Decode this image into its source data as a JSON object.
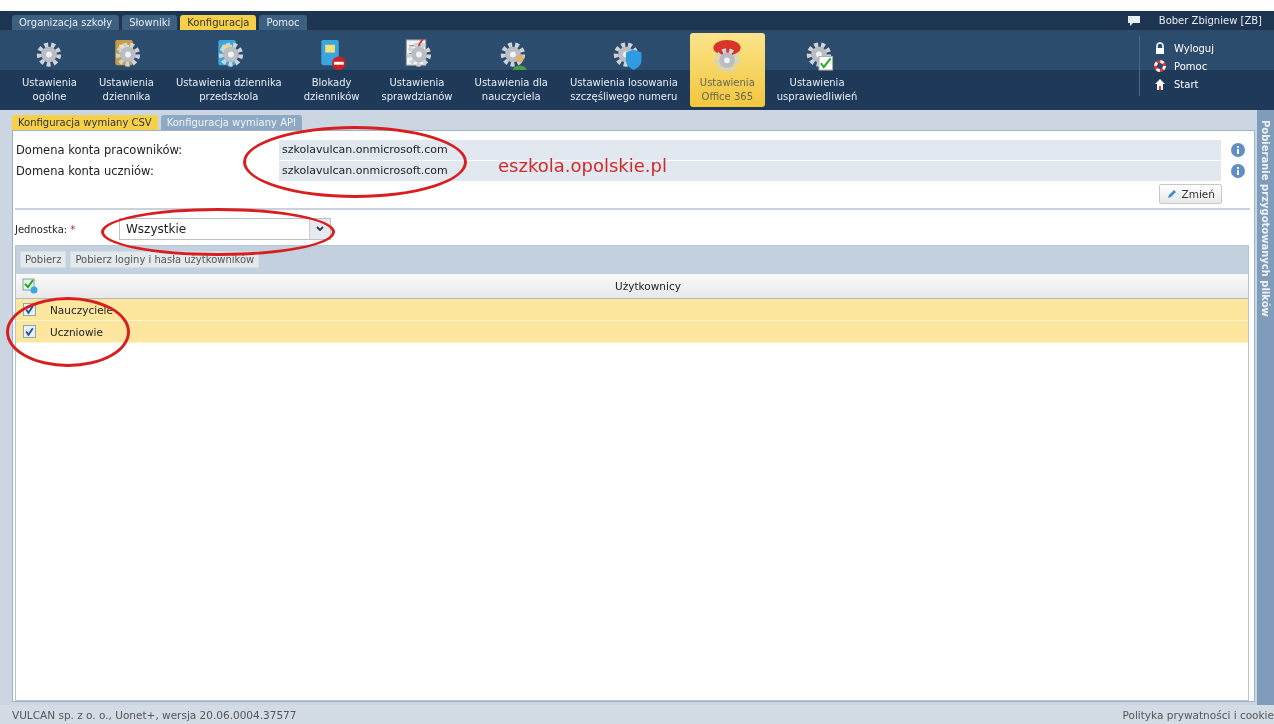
{
  "top_tabs": [
    {
      "label": "Organizacja szkoły",
      "selected": false
    },
    {
      "label": "Słowniki",
      "selected": false
    },
    {
      "label": "Konfiguracja",
      "selected": true
    },
    {
      "label": "Pomoc",
      "selected": false
    }
  ],
  "user": {
    "name": "Bober Zbigniew [ZB]"
  },
  "toolbar": [
    {
      "label": "Ustawienia\nogólne",
      "kind": "gear",
      "selected": false
    },
    {
      "label": "Ustawienia\ndziennika",
      "kind": "book",
      "selected": false
    },
    {
      "label": "Ustawienia dziennika\nprzedszkola",
      "kind": "bluebook",
      "selected": false
    },
    {
      "label": "Blokady\ndzienników",
      "kind": "block",
      "selected": false
    },
    {
      "label": "Ustawienia\nsprawdzianów",
      "kind": "test",
      "selected": false
    },
    {
      "label": "Ustawienia dla\nnauczyciela",
      "kind": "person",
      "selected": false
    },
    {
      "label": "Ustawienia losowania\nszczęśliwego numeru",
      "kind": "shield",
      "selected": false
    },
    {
      "label": "Ustawienia\nOffice 365",
      "kind": "cloud",
      "selected": true
    },
    {
      "label": "Ustawienia\nusprawiedliwień",
      "kind": "check",
      "selected": false
    }
  ],
  "side_links": [
    {
      "label": "Wyloguj",
      "kind": "lock"
    },
    {
      "label": "Pomoc",
      "kind": "lifebuoy"
    },
    {
      "label": "Start",
      "kind": "home"
    }
  ],
  "sub_tabs": [
    {
      "label": "Konfiguracja wymiany CSV",
      "selected": true
    },
    {
      "label": "Konfiguracja wymiany API",
      "selected": false
    }
  ],
  "domain_fields": [
    {
      "label": "Domena konta pracowników:",
      "value": "szkolavulcan.onmicrosoft.com"
    },
    {
      "label": "Domena konta uczniów:",
      "value": "szkolavulcan.onmicrosoft.com"
    }
  ],
  "change_button": "Zmień",
  "unit": {
    "label": "Jednostka:",
    "required_mark": "*",
    "value": "Wszystkie"
  },
  "grid_buttons": [
    "Pobierz",
    "Pobierz loginy i hasła użytkowników"
  ],
  "table": {
    "column": "Użytkownicy",
    "rows": [
      {
        "name": "Nauczyciele",
        "checked": true,
        "selected": true
      },
      {
        "name": "Uczniowie",
        "checked": true,
        "selected": true
      }
    ]
  },
  "side_panel": {
    "title": "Pobieranie przygotowanych plików"
  },
  "annotation": {
    "text": "eszkola.opolskie.pl"
  },
  "status_bar": {
    "left": "VULCAN sp. z o. o., Uonet+, wersja 20.06.0004.37577",
    "right": "Polityka prywatności i cookie"
  }
}
